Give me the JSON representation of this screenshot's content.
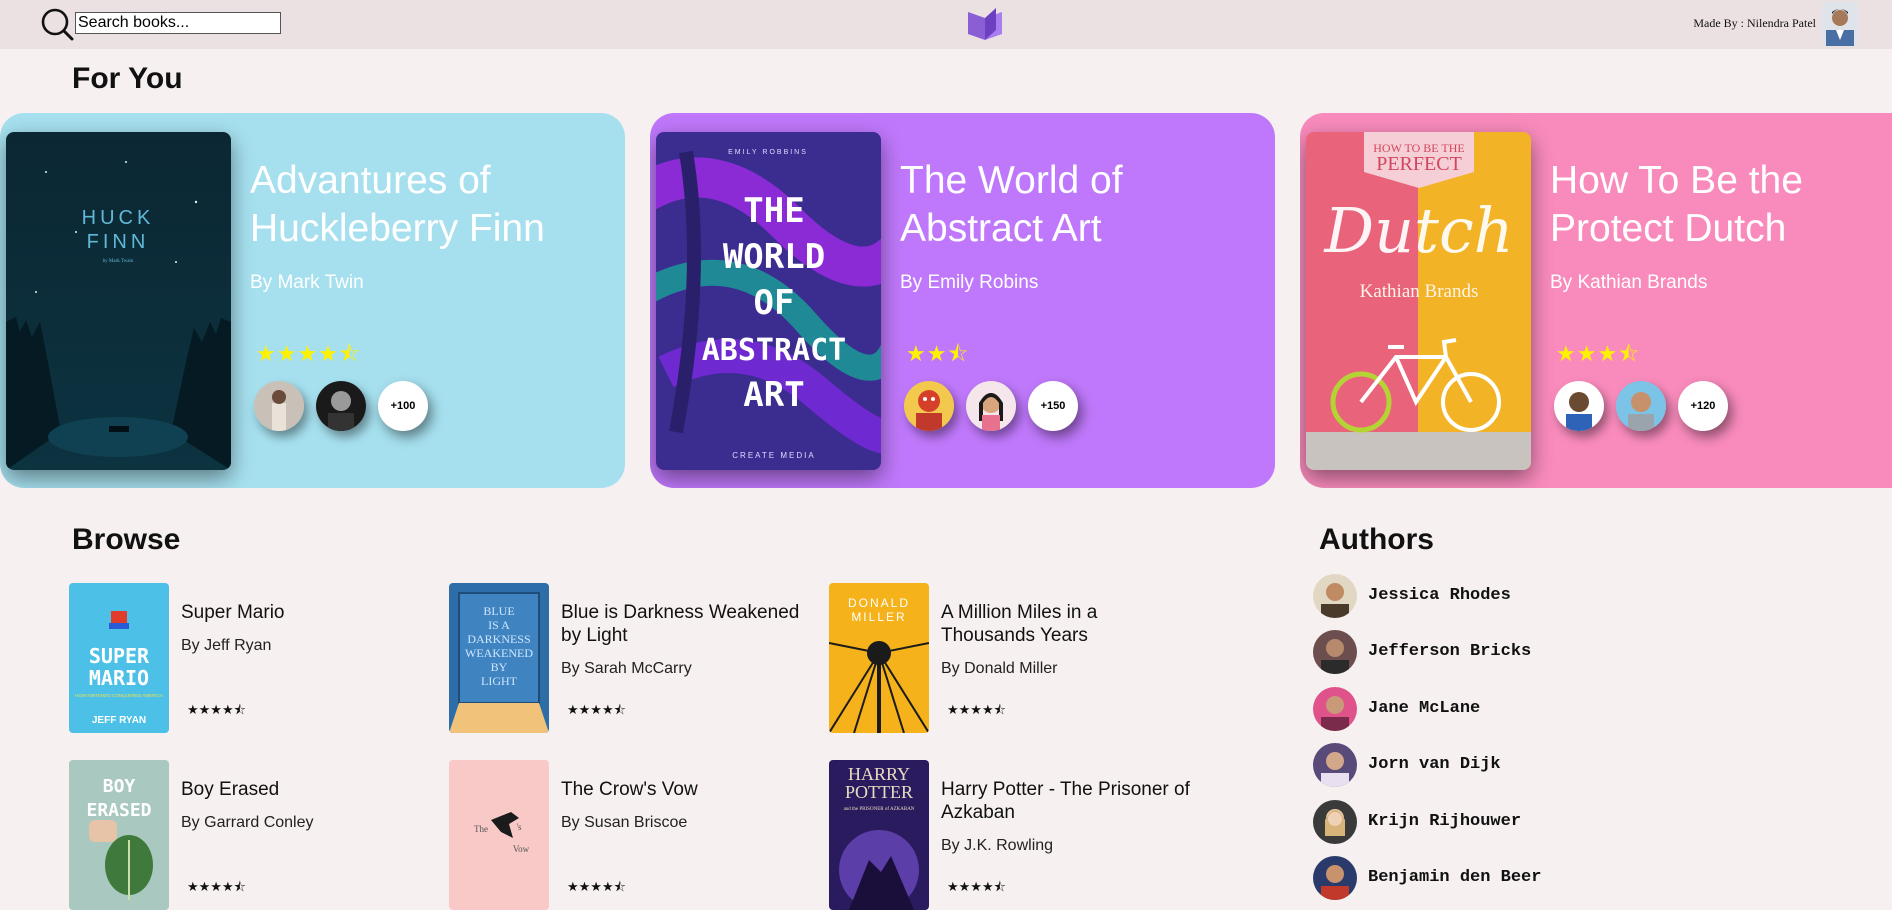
{
  "header": {
    "search_placeholder": "Search books...",
    "made_by": "Made By : Nilendra Patel"
  },
  "colors": {
    "accent_purple": "#8a5fd6",
    "card_blue": "#a6e0ef",
    "card_purple": "#bf78fb",
    "card_pink": "#f98bbc",
    "star_yellow": "#fff200"
  },
  "for_you": {
    "title": "For You",
    "cards": [
      {
        "title": "Advantures of Huckleberry Finn",
        "author": "By Mark Twin",
        "stars": "★★★★⯪",
        "reader_count": "+100",
        "cover_lines": [
          "HUCK",
          "FINN"
        ],
        "cover_sub": "by Mark Twain"
      },
      {
        "title": "The World of Abstract Art",
        "author": "By Emily Robins",
        "stars": "★★⯪",
        "reader_count": "+150",
        "cover_top": "EMILY ROBBINS",
        "cover_lines": [
          "THE",
          "WORLD",
          "OF",
          "ABSTRACT",
          "ART"
        ],
        "cover_bottom": "CREATE MEDIA"
      },
      {
        "title": "How To Be the Protect Dutch",
        "author": "By Kathian Brands",
        "stars": "★★★⯪",
        "reader_count": "+120",
        "cover_top": "HOW TO BE THE",
        "cover_perfect": "PERFECT",
        "cover_main": "Dutch",
        "cover_author": "Kathian Brands"
      }
    ]
  },
  "browse": {
    "title": "Browse",
    "items": [
      {
        "title": "Super Mario",
        "author": "By Jeff Ryan",
        "stars": "★★★★⯪",
        "cover_lines": [
          "SUPER",
          "MARIO"
        ],
        "cover_sub": "HOW NINTENDO CONQUERED AMERICA",
        "cover_author": "JEFF RYAN"
      },
      {
        "title": "Blue is Darkness Weakened by Light",
        "author": "By Sarah McCarry",
        "stars": "★★★★⯪",
        "cover_lines": [
          "BLUE",
          "IS A",
          "DARKNESS",
          "WEAKENED",
          "BY",
          "LIGHT"
        ]
      },
      {
        "title": "A Million Miles in a Thousands Years",
        "author": "By Donald Miller",
        "stars": "★★★★⯪",
        "cover_lines": [
          "DONALD",
          "MILLER"
        ]
      },
      {
        "title": "Boy Erased",
        "author": "By Garrard Conley",
        "stars": "★★★★⯪",
        "cover_lines": [
          "BOY",
          "ERASED"
        ]
      },
      {
        "title": "The Crow's Vow",
        "author": "By Susan Briscoe",
        "stars": "★★★★⯪",
        "cover_lines": [
          "The",
          "'s",
          "Vow"
        ]
      },
      {
        "title": "Harry Potter - The Prisoner of Azkaban",
        "author": "By J.K. Rowling",
        "stars": "★★★★⯪",
        "cover_lines": [
          "HARRY",
          "POTTER"
        ],
        "cover_sub": "and the PRISONER of AZKABAN"
      }
    ]
  },
  "authors": {
    "title": "Authors",
    "items": [
      {
        "name": "Jessica Rhodes"
      },
      {
        "name": "Jefferson Bricks"
      },
      {
        "name": "Jane McLane"
      },
      {
        "name": "Jorn van Dijk"
      },
      {
        "name": "Krijn Rijhouwer"
      },
      {
        "name": "Benjamin den Beer"
      }
    ]
  }
}
